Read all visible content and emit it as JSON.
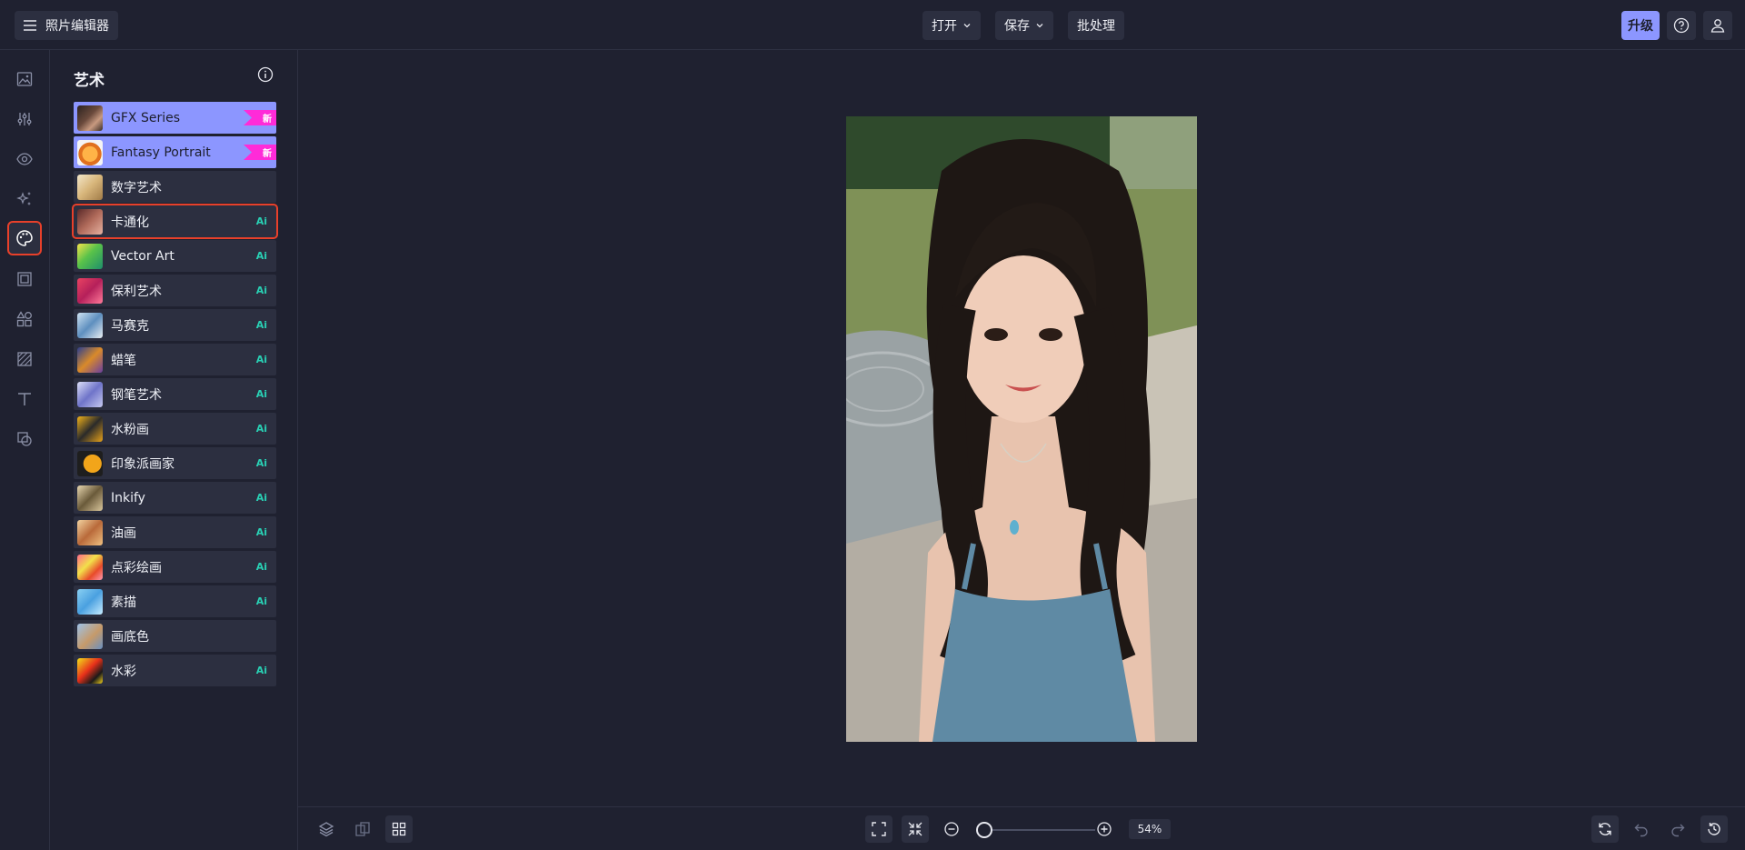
{
  "header": {
    "app_title": "照片编辑器",
    "open_label": "打开",
    "save_label": "保存",
    "batch_label": "批处理",
    "upgrade_label": "升级"
  },
  "rail": {
    "items": [
      {
        "icon": "image-icon"
      },
      {
        "icon": "sliders-icon"
      },
      {
        "icon": "eye-icon"
      },
      {
        "icon": "sparkle-icon"
      },
      {
        "icon": "palette-icon",
        "active": true
      },
      {
        "icon": "frame-icon"
      },
      {
        "icon": "shapes-icon"
      },
      {
        "icon": "texture-icon"
      },
      {
        "icon": "text-icon"
      },
      {
        "icon": "overlay-icon"
      }
    ]
  },
  "panel": {
    "title": "艺术",
    "effects": [
      {
        "label": "GFX Series",
        "badge": "新",
        "featured": true
      },
      {
        "label": "Fantasy Portrait",
        "badge": "新",
        "featured": true
      },
      {
        "label": "数字艺术",
        "badge": ""
      },
      {
        "label": "卡通化",
        "badge": "Ai",
        "selected": true
      },
      {
        "label": "Vector Art",
        "badge": "Ai"
      },
      {
        "label": "保利艺术",
        "badge": "Ai"
      },
      {
        "label": "马赛克",
        "badge": "Ai"
      },
      {
        "label": "蜡笔",
        "badge": "Ai"
      },
      {
        "label": "钢笔艺术",
        "badge": "Ai"
      },
      {
        "label": "水粉画",
        "badge": "Ai"
      },
      {
        "label": "印象派画家",
        "badge": "Ai"
      },
      {
        "label": "Inkify",
        "badge": "Ai"
      },
      {
        "label": "油画",
        "badge": "Ai"
      },
      {
        "label": "点彩绘画",
        "badge": "Ai"
      },
      {
        "label": "素描",
        "badge": "Ai"
      },
      {
        "label": "画底色",
        "badge": ""
      },
      {
        "label": "水彩",
        "badge": "Ai"
      }
    ]
  },
  "zoom": {
    "value_label": "54%",
    "level": 0.54
  },
  "colors": {
    "accent": "#8c96ff",
    "new_badge": "#ff2bd8",
    "ai_badge": "#29d0b4",
    "selection": "#e8402a",
    "background": "#1f2130",
    "surface": "#2c2f40"
  }
}
